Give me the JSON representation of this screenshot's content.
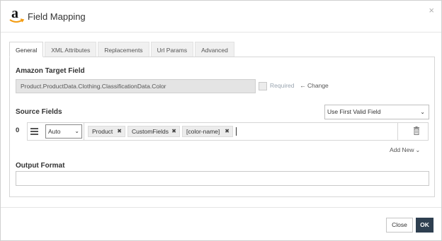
{
  "dialog": {
    "title": "Field Mapping",
    "close_glyph": "×",
    "logo_icon": "amazon-logo-icon"
  },
  "tabs": [
    {
      "label": "General",
      "active": true
    },
    {
      "label": "XML Attributes",
      "active": false
    },
    {
      "label": "Replacements",
      "active": false
    },
    {
      "label": "Url Params",
      "active": false
    },
    {
      "label": "Advanced",
      "active": false
    }
  ],
  "target": {
    "heading": "Amazon Target Field",
    "value": "Product.ProductData.Clothing.ClassificationData.Color",
    "required_label": "Required",
    "required_checked": false,
    "change_label": "Change"
  },
  "source": {
    "heading": "Source Fields",
    "strategy": "Use First Valid Field",
    "rows": [
      {
        "index": "0",
        "type": "Auto",
        "tokens": [
          "Product",
          "CustomFields",
          "[color-name]"
        ]
      }
    ],
    "add_new_label": "Add New"
  },
  "output": {
    "heading": "Output Format",
    "value": ""
  },
  "footer": {
    "close_label": "Close",
    "ok_label": "OK"
  },
  "colors": {
    "primary_button": "#2e3f50",
    "token_bg": "#ececec",
    "readonly_field_bg": "#e4e4e4",
    "required_label": "#9aa5b0"
  }
}
